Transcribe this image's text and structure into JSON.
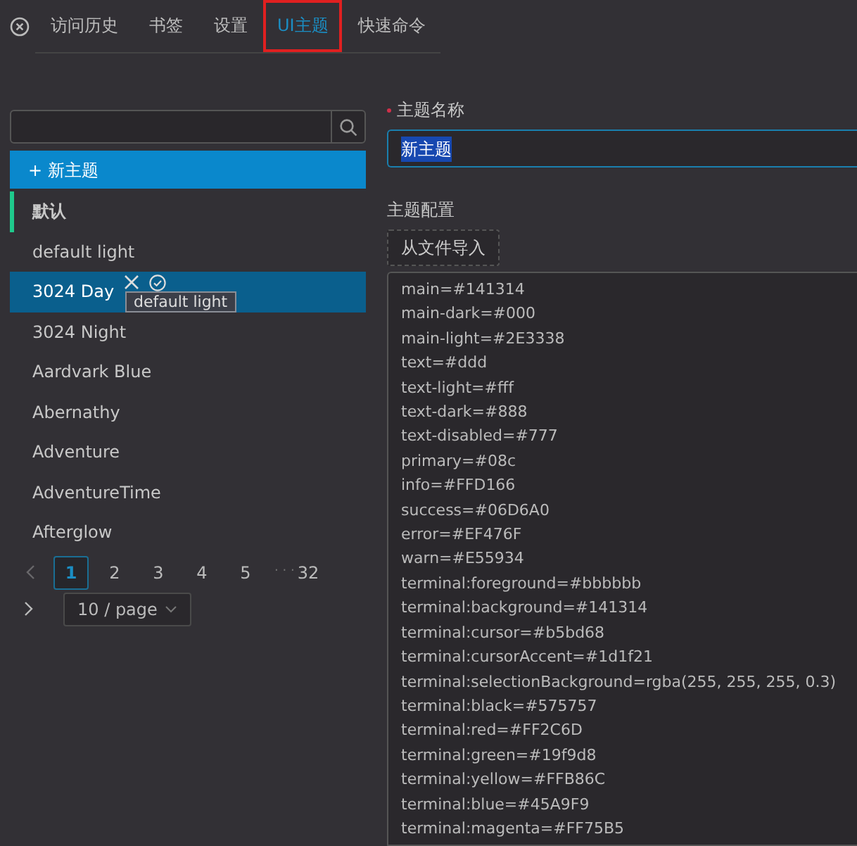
{
  "tabs": [
    {
      "label": "访问历史",
      "selected": false,
      "highlighted": false
    },
    {
      "label": "书签",
      "selected": false,
      "highlighted": false
    },
    {
      "label": "设置",
      "selected": false,
      "highlighted": false
    },
    {
      "label": "UI主题",
      "selected": true,
      "highlighted": true
    },
    {
      "label": "快速命令",
      "selected": false,
      "highlighted": false
    }
  ],
  "sidebar": {
    "new_button": {
      "icon": "+",
      "label": "新主题"
    },
    "items": [
      {
        "label": "默认",
        "current": true,
        "selected": false
      },
      {
        "label": "default light",
        "current": false,
        "selected": false
      },
      {
        "label": "3024 Day",
        "current": false,
        "selected": true,
        "tooltip": "default light"
      },
      {
        "label": "3024 Night",
        "current": false,
        "selected": false
      },
      {
        "label": "Aardvark Blue",
        "current": false,
        "selected": false
      },
      {
        "label": "Abernathy",
        "current": false,
        "selected": false
      },
      {
        "label": "Adventure",
        "current": false,
        "selected": false
      },
      {
        "label": "AdventureTime",
        "current": false,
        "selected": false
      },
      {
        "label": "Afterglow",
        "current": false,
        "selected": false
      }
    ],
    "pagination": {
      "prev_disabled": true,
      "pages": [
        {
          "label": "1",
          "selected": true
        },
        {
          "label": "2",
          "selected": false
        },
        {
          "label": "3",
          "selected": false
        },
        {
          "label": "4",
          "selected": false
        },
        {
          "label": "5",
          "selected": false
        }
      ],
      "ellipsis": "· · ·",
      "last": "32",
      "page_size": "10 / page"
    }
  },
  "form": {
    "name_label": "主题名称",
    "name_required": true,
    "name_value": "新主题",
    "config_label": "主题配置",
    "import_button": "从文件导入",
    "config_lines": [
      "main=#141314",
      "main-dark=#000",
      "main-light=#2E3338",
      "text=#ddd",
      "text-light=#fff",
      "text-dark=#888",
      "text-disabled=#777",
      "primary=#08c",
      "info=#FFD166",
      "success=#06D6A0",
      "error=#EF476F",
      "warn=#E55934",
      "terminal:foreground=#bbbbbb",
      "terminal:background=#141314",
      "terminal:cursor=#b5bd68",
      "terminal:cursorAccent=#1d1f21",
      "terminal:selectionBackground=rgba(255, 255, 255, 0.3)",
      "terminal:black=#575757",
      "terminal:red=#FF2C6D",
      "terminal:green=#19f9d8",
      "terminal:yellow=#FFB86C",
      "terminal:blue=#45A9F9",
      "terminal:magenta=#FF75B5"
    ]
  }
}
